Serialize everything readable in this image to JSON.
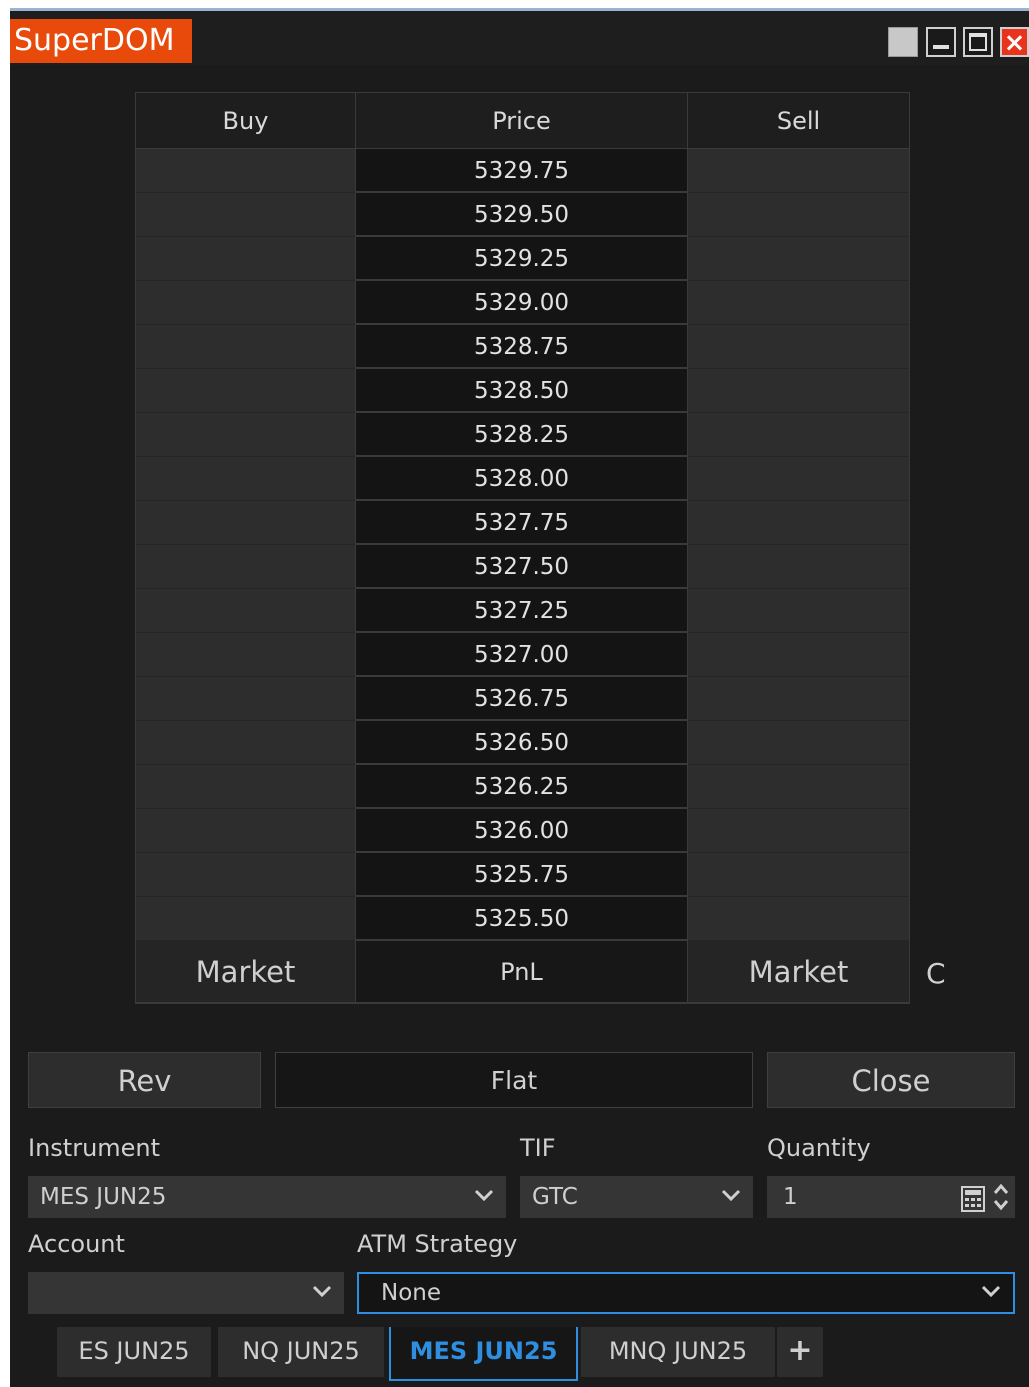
{
  "window": {
    "title": "SuperDOM"
  },
  "ladder": {
    "headers": {
      "buy": "Buy",
      "price": "Price",
      "sell": "Sell"
    },
    "prices": [
      "5329.75",
      "5329.50",
      "5329.25",
      "5329.00",
      "5328.75",
      "5328.50",
      "5328.25",
      "5328.00",
      "5327.75",
      "5327.50",
      "5327.25",
      "5327.00",
      "5326.75",
      "5326.50",
      "5326.25",
      "5326.00",
      "5325.75",
      "5325.50"
    ],
    "footer": {
      "buy_market": "Market",
      "pnl": "PnL",
      "sell_market": "Market",
      "c_button": "C"
    }
  },
  "actions": {
    "rev": "Rev",
    "flat": "Flat",
    "close": "Close"
  },
  "form": {
    "instrument_label": "Instrument",
    "instrument_value": "MES JUN25",
    "tif_label": "TIF",
    "tif_value": "GTC",
    "quantity_label": "Quantity",
    "quantity_value": "1",
    "account_label": "Account",
    "account_value": "",
    "atm_label": "ATM Strategy",
    "atm_value": "None"
  },
  "tabs": [
    {
      "label": "ES JUN25",
      "active": false
    },
    {
      "label": "NQ JUN25",
      "active": false
    },
    {
      "label": "MES JUN25",
      "active": true
    },
    {
      "label": "MNQ JUN25",
      "active": false
    },
    {
      "label": "+",
      "active": false
    }
  ],
  "colors": {
    "accent": "#2f8ee0",
    "title_bg": "#e84a0c",
    "bg": "#1b1b1b"
  }
}
